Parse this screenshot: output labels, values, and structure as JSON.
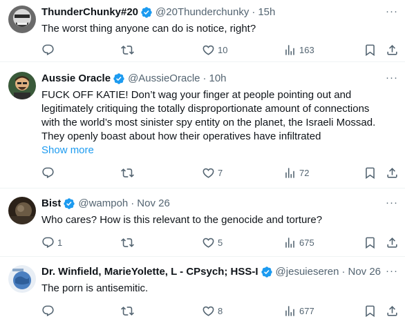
{
  "tweets": [
    {
      "name": "ThunderChunky#20",
      "handle": "@20Thunderchunky",
      "time": "15h",
      "text": "The worst thing anyone can do is notice, right?",
      "replies": "",
      "retweets": "",
      "likes": "10",
      "views": "163"
    },
    {
      "name": "Aussie Oracle",
      "handle": "@AussieOracle",
      "time": "10h",
      "text_lines": [
        "FUCK OFF KATIE! Don’t wag your finger at people pointing out and",
        "legitimately critiquing the totally disproportionate amount of connections",
        "with the world’s most sinister spy entity on the planet, the Israeli Mossad.",
        "They openly boast about how their operatives have infiltrated"
      ],
      "show_more": "Show more",
      "replies": "",
      "retweets": "",
      "likes": "7",
      "views": "72"
    },
    {
      "name": "Bist",
      "handle": "@wampoh",
      "time": "Nov 26",
      "text": "Who cares? How is this relevant to the genocide and torture?",
      "replies": "1",
      "retweets": "",
      "likes": "5",
      "views": "675"
    },
    {
      "name": "Dr. Winfield, MarieYolette, L - CPsych; HSS-I",
      "handle": "@jesuieseren",
      "time": "Nov 26",
      "text": "The porn is antisemitic.",
      "replies": "",
      "retweets": "",
      "likes": "8",
      "views": "677"
    }
  ],
  "separator": "·",
  "more_glyph": "···",
  "colors": {
    "verified": "#1d9bf0",
    "link": "#1d9bf0",
    "secondary_text": "#536471",
    "divider": "#eff3f4"
  },
  "icons": [
    "reply-icon",
    "retweet-icon",
    "like-icon",
    "views-icon",
    "bookmark-icon",
    "share-icon",
    "verified-badge-icon",
    "more-icon"
  ]
}
